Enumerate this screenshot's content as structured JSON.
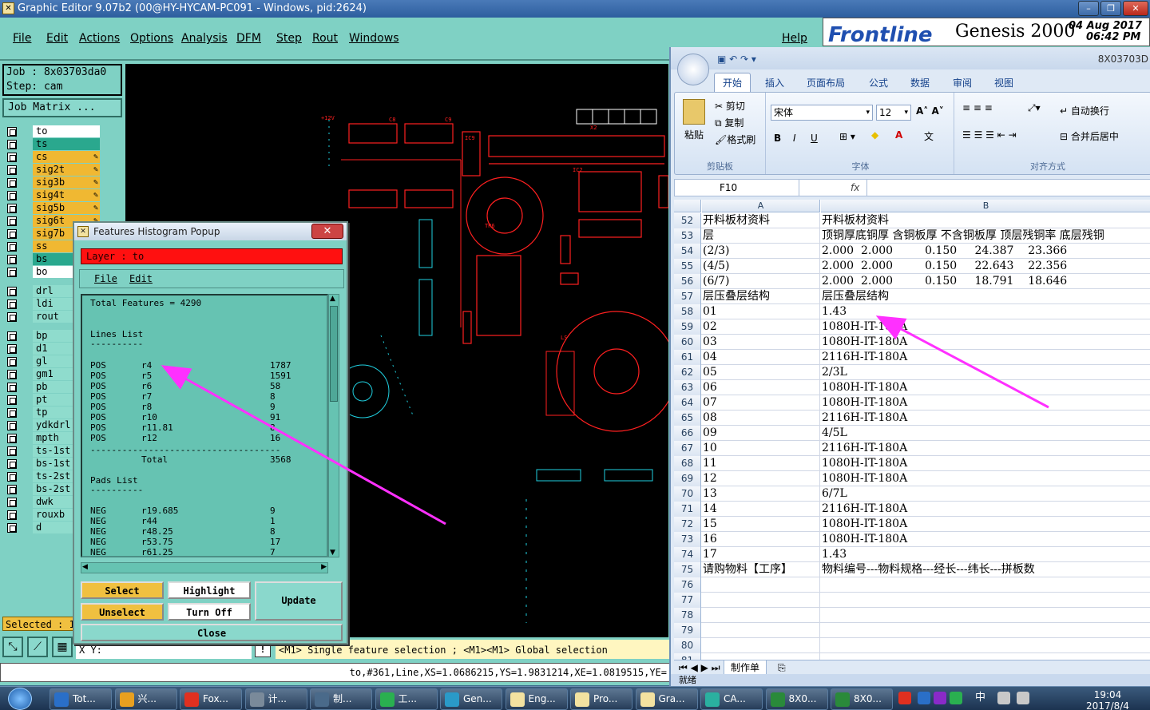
{
  "genesis": {
    "title": "Graphic Editor 9.07b2 (00@HY-HYCAM-PC091 - Windows, pid:2624)",
    "menu": [
      "File",
      "Edit",
      "Actions",
      "Options",
      "Analysis",
      "DFM",
      "Step",
      "Rout",
      "Windows"
    ],
    "help": "Help",
    "logo_brand": "Frontline",
    "logo_product": "Genesis 2000",
    "logo_date": "04 Aug 2017",
    "logo_time": "06:42 PM",
    "job": "Job : 8x03703da0",
    "step": "Step: cam",
    "job_matrix": "Job Matrix ...",
    "layers": [
      {
        "name": "to",
        "color": "#ffffff"
      },
      {
        "name": "ts",
        "color": "#2aa88e"
      },
      {
        "name": "cs",
        "color": "#f0b832"
      },
      {
        "name": "sig2t",
        "color": "#f0b832"
      },
      {
        "name": "sig3b",
        "color": "#f0b832"
      },
      {
        "name": "sig4t",
        "color": "#f0b832"
      },
      {
        "name": "sig5b",
        "color": "#f0b832"
      },
      {
        "name": "sig6t",
        "color": "#f0b832"
      },
      {
        "name": "sig7b",
        "color": "#f0b832"
      },
      {
        "name": "ss",
        "color": "#f0b832"
      },
      {
        "name": "bs",
        "color": "#2aa88e"
      },
      {
        "name": "bo",
        "color": "#ffffff"
      },
      {
        "name": "drl",
        "color": "#8fdccd"
      },
      {
        "name": "ldi",
        "color": "#8fdccd"
      },
      {
        "name": "rout",
        "color": "#8fdccd"
      },
      {
        "name": "bp",
        "color": "#8fdccd"
      },
      {
        "name": "d1",
        "color": "#8fdccd"
      },
      {
        "name": "gl",
        "color": "#8fdccd"
      },
      {
        "name": "gm1",
        "color": "#8fdccd"
      },
      {
        "name": "pb",
        "color": "#8fdccd"
      },
      {
        "name": "pt",
        "color": "#8fdccd"
      },
      {
        "name": "tp",
        "color": "#8fdccd"
      },
      {
        "name": "ydkdrl",
        "color": "#8fdccd"
      },
      {
        "name": "mpth",
        "color": "#8fdccd"
      },
      {
        "name": "ts-1st",
        "color": "#8fdccd"
      },
      {
        "name": "bs-1st",
        "color": "#8fdccd"
      },
      {
        "name": "ts-2st",
        "color": "#8fdccd"
      },
      {
        "name": "bs-2st",
        "color": "#8fdccd"
      },
      {
        "name": "dwk",
        "color": "#8fdccd"
      },
      {
        "name": "rouxb",
        "color": "#8fdccd"
      },
      {
        "name": "d",
        "color": "#8fdccd"
      }
    ],
    "selected": "Selected : 1",
    "status_msg": "<M1>   Single feature selection ; <M1><M1> Global selection",
    "coord_prefix": "X Y:",
    "bottom_cmd": "to,#361,Line,XS=1.0686215,YS=1.9831214,XE=1.0819515,YE="
  },
  "histogram": {
    "title": "Features Histogram Popup",
    "layer": "Layer :  to",
    "menu": [
      "File",
      "Edit"
    ],
    "total_features": "Total Features = 4290",
    "lines_header": "Lines List",
    "lines": [
      {
        "pol": "POS",
        "sym": "r4",
        "count": "1787"
      },
      {
        "pol": "POS",
        "sym": "r5",
        "count": "1591"
      },
      {
        "pol": "POS",
        "sym": "r6",
        "count": "58"
      },
      {
        "pol": "POS",
        "sym": "r7",
        "count": "8"
      },
      {
        "pol": "POS",
        "sym": "r8",
        "count": "9"
      },
      {
        "pol": "POS",
        "sym": "r10",
        "count": "91"
      },
      {
        "pol": "POS",
        "sym": "r11.81",
        "count": "8"
      },
      {
        "pol": "POS",
        "sym": "r12",
        "count": "16"
      }
    ],
    "total_label": "Total",
    "total_value": "3568",
    "pads_header": "Pads List",
    "pads": [
      {
        "pol": "NEG",
        "sym": "r19.685",
        "count": "9"
      },
      {
        "pol": "NEG",
        "sym": "r44",
        "count": "1"
      },
      {
        "pol": "NEG",
        "sym": "r48.25",
        "count": "8"
      },
      {
        "pol": "NEG",
        "sym": "r53.75",
        "count": "17"
      },
      {
        "pol": "NEG",
        "sym": "r61.25",
        "count": "7"
      }
    ],
    "btn_select": "Select",
    "btn_unselect": "Unselect",
    "btn_highlight": "Highlight",
    "btn_turnoff": "Turn Off",
    "btn_update": "Update",
    "btn_close": "Close"
  },
  "excel": {
    "title": "8X03703D",
    "tabs": [
      "开始",
      "插入",
      "页面布局",
      "公式",
      "数据",
      "审阅",
      "视图"
    ],
    "clipboard": {
      "paste": "粘贴",
      "cut": "剪切",
      "copy": "复制",
      "format": "格式刷",
      "label": "剪贴板"
    },
    "font": {
      "name": "宋体",
      "size": "12",
      "label": "字体"
    },
    "align": {
      "wrap": "自动换行",
      "merge": "合并后居中",
      "label": "对齐方式"
    },
    "cell_ref": "F10",
    "fx": "fx",
    "col_a": "A",
    "col_b": "B",
    "rows": [
      {
        "n": "52",
        "a": "开料板材资料",
        "b": "开料板材资料"
      },
      {
        "n": "53",
        "a": "层",
        "b": "顶铜厚底铜厚 含铜板厚 不含铜板厚 顶层残铜率 底层残铜"
      },
      {
        "n": "54",
        "a": "(2/3)",
        "b": "2.000  2.000         0.150     24.387    23.366"
      },
      {
        "n": "55",
        "a": "(4/5)",
        "b": "2.000  2.000         0.150     22.643    22.356"
      },
      {
        "n": "56",
        "a": "(6/7)",
        "b": "2.000  2.000         0.150     18.791    18.646"
      },
      {
        "n": "57",
        "a": "层压叠层结构",
        "b": "层压叠层结构"
      },
      {
        "n": "58",
        "a": "01",
        "b": "1.43"
      },
      {
        "n": "59",
        "a": "02",
        "b": "1080H-IT-180A"
      },
      {
        "n": "60",
        "a": "03",
        "b": "1080H-IT-180A"
      },
      {
        "n": "61",
        "a": "04",
        "b": "2116H-IT-180A"
      },
      {
        "n": "62",
        "a": "05",
        "b": "2/3L"
      },
      {
        "n": "63",
        "a": "06",
        "b": "1080H-IT-180A"
      },
      {
        "n": "64",
        "a": "07",
        "b": "1080H-IT-180A"
      },
      {
        "n": "65",
        "a": "08",
        "b": "2116H-IT-180A"
      },
      {
        "n": "66",
        "a": "09",
        "b": "4/5L"
      },
      {
        "n": "67",
        "a": "10",
        "b": "2116H-IT-180A"
      },
      {
        "n": "68",
        "a": "11",
        "b": "1080H-IT-180A"
      },
      {
        "n": "69",
        "a": "12",
        "b": "1080H-IT-180A"
      },
      {
        "n": "70",
        "a": "13",
        "b": "6/7L"
      },
      {
        "n": "71",
        "a": "14",
        "b": "2116H-IT-180A"
      },
      {
        "n": "72",
        "a": "15",
        "b": "1080H-IT-180A"
      },
      {
        "n": "73",
        "a": "16",
        "b": "1080H-IT-180A"
      },
      {
        "n": "74",
        "a": "17",
        "b": "1.43"
      },
      {
        "n": "75",
        "a": "请购物料【工序】",
        "b": "物料编号---物料规格---经长---纬长---拼板数"
      },
      {
        "n": "76",
        "a": "",
        "b": ""
      },
      {
        "n": "77",
        "a": "",
        "b": ""
      },
      {
        "n": "78",
        "a": "",
        "b": ""
      },
      {
        "n": "79",
        "a": "",
        "b": ""
      },
      {
        "n": "80",
        "a": "",
        "b": ""
      },
      {
        "n": "81",
        "a": "",
        "b": ""
      }
    ],
    "sheet_tab": "制作单",
    "status": "就绪"
  },
  "taskbar": {
    "items": [
      "Tot...",
      "兴...",
      "Fox...",
      "计...",
      "制...",
      "工...",
      "Gen...",
      "Eng...",
      "Pro...",
      "Gra...",
      "CA...",
      "8X0...",
      "8X0..."
    ],
    "ime": "中",
    "time": "19:04",
    "date": "2017/8/4"
  },
  "colors": {
    "accent_arrow": "#ff30ff",
    "genesis_bg": "#7fd1c4",
    "layer_red": "#ff1010"
  }
}
